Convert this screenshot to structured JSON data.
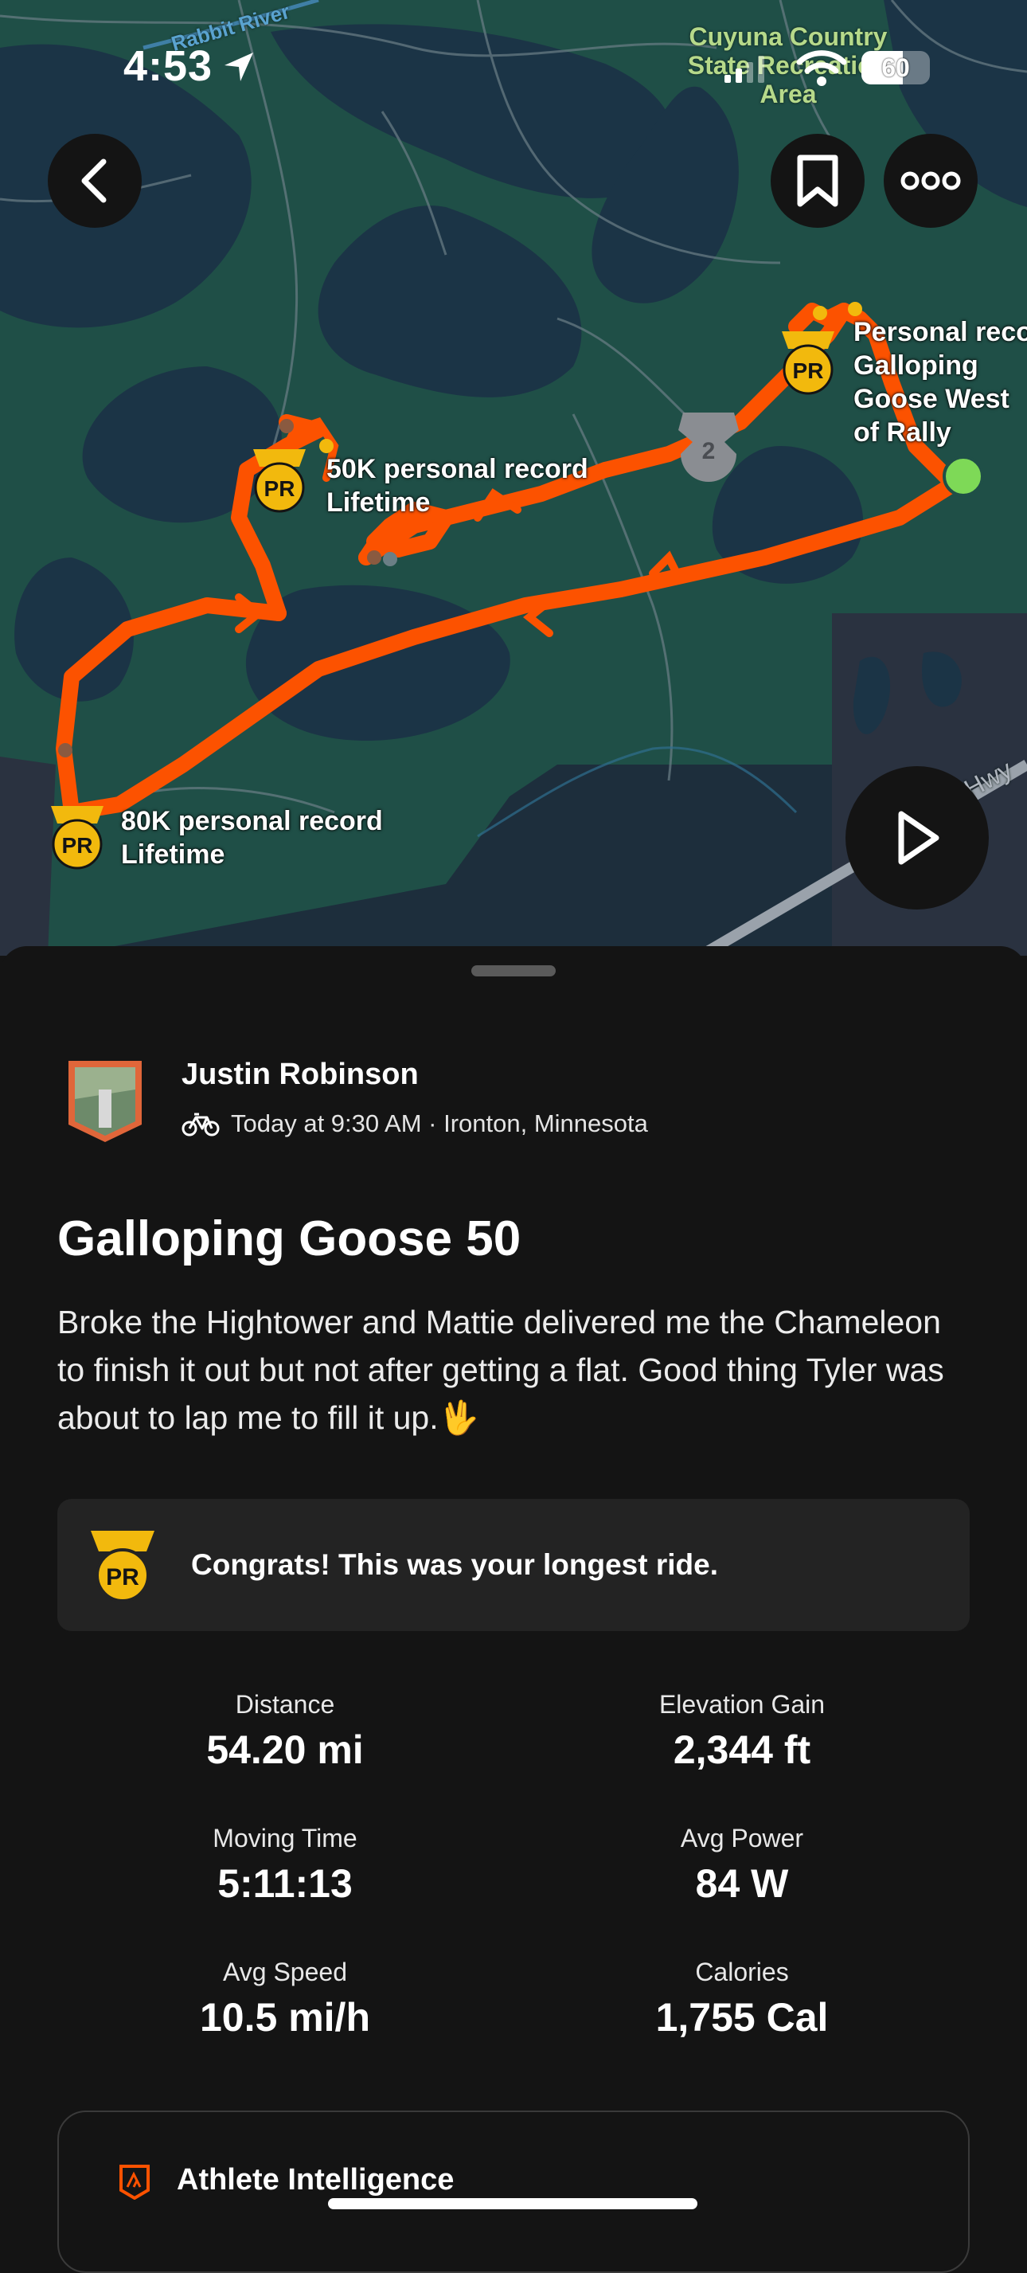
{
  "status_bar": {
    "time": "4:53",
    "battery": "60"
  },
  "map": {
    "area_label": "Cuyuna Country State Recreation Area",
    "river_label": "Rabbit River",
    "highway_label": "Hwy",
    "segment_rank": "2",
    "records": [
      {
        "badge": "PR",
        "title": "50K personal record",
        "subtitle": "Lifetime"
      },
      {
        "badge": "PR",
        "title": "80K personal record",
        "subtitle": "Lifetime"
      },
      {
        "badge": "PR",
        "title": "Personal record",
        "subtitle": "Galloping Goose West of Rally"
      }
    ],
    "colors": {
      "route": "#fc5200",
      "land": "#1f4f47",
      "water": "#1b3446",
      "start": "#7ed957",
      "pr_gold": "#f2b90d"
    }
  },
  "activity": {
    "athlete": "Justin Robinson",
    "meta": "Today at 9:30 AM · Ironton, Minnesota",
    "title": "Galloping Goose 50",
    "description": "Broke the Hightower and Mattie delivered me the Chameleon to finish it out but not after getting a flat. Good thing Tyler was about to lap me to fill it up.",
    "description_emoji": "🖖",
    "congrats": "Congrats! This was your longest ride.",
    "stats": [
      {
        "label": "Distance",
        "value": "54.20 mi"
      },
      {
        "label": "Elevation Gain",
        "value": "2,344 ft"
      },
      {
        "label": "Moving Time",
        "value": "5:11:13"
      },
      {
        "label": "Avg Power",
        "value": "84 W"
      },
      {
        "label": "Avg Speed",
        "value": "10.5 mi/h"
      },
      {
        "label": "Calories",
        "value": "1,755 Cal"
      }
    ],
    "athlete_intelligence": "Athlete Intelligence"
  }
}
